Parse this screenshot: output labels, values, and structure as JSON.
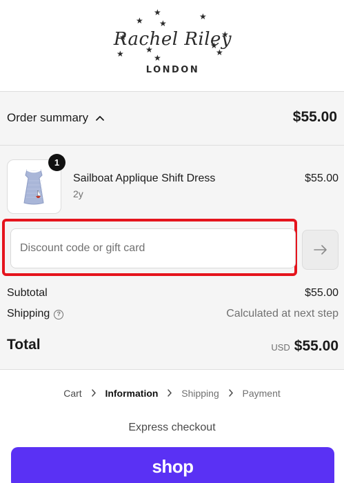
{
  "brand": {
    "script_name": "Rachel Riley",
    "city": "LONDON"
  },
  "summary": {
    "toggle_label": "Order summary",
    "total": "$55.00"
  },
  "line_item": {
    "quantity": "1",
    "name": "Sailboat Applique Shift Dress",
    "variant": "2y",
    "price": "$55.00"
  },
  "discount": {
    "placeholder": "Discount code or gift card"
  },
  "totals": {
    "subtotal_label": "Subtotal",
    "subtotal_value": "$55.00",
    "shipping_label": "Shipping",
    "shipping_value": "Calculated at next step",
    "total_label": "Total",
    "currency": "USD",
    "total_value": "$55.00"
  },
  "breadcrumb": {
    "cart": "Cart",
    "information": "Information",
    "shipping": "Shipping",
    "payment": "Payment"
  },
  "express": {
    "label": "Express checkout",
    "shop_button": "shop"
  },
  "colors": {
    "shop_purple": "#5a31f4",
    "highlight_red": "#e5141d"
  }
}
